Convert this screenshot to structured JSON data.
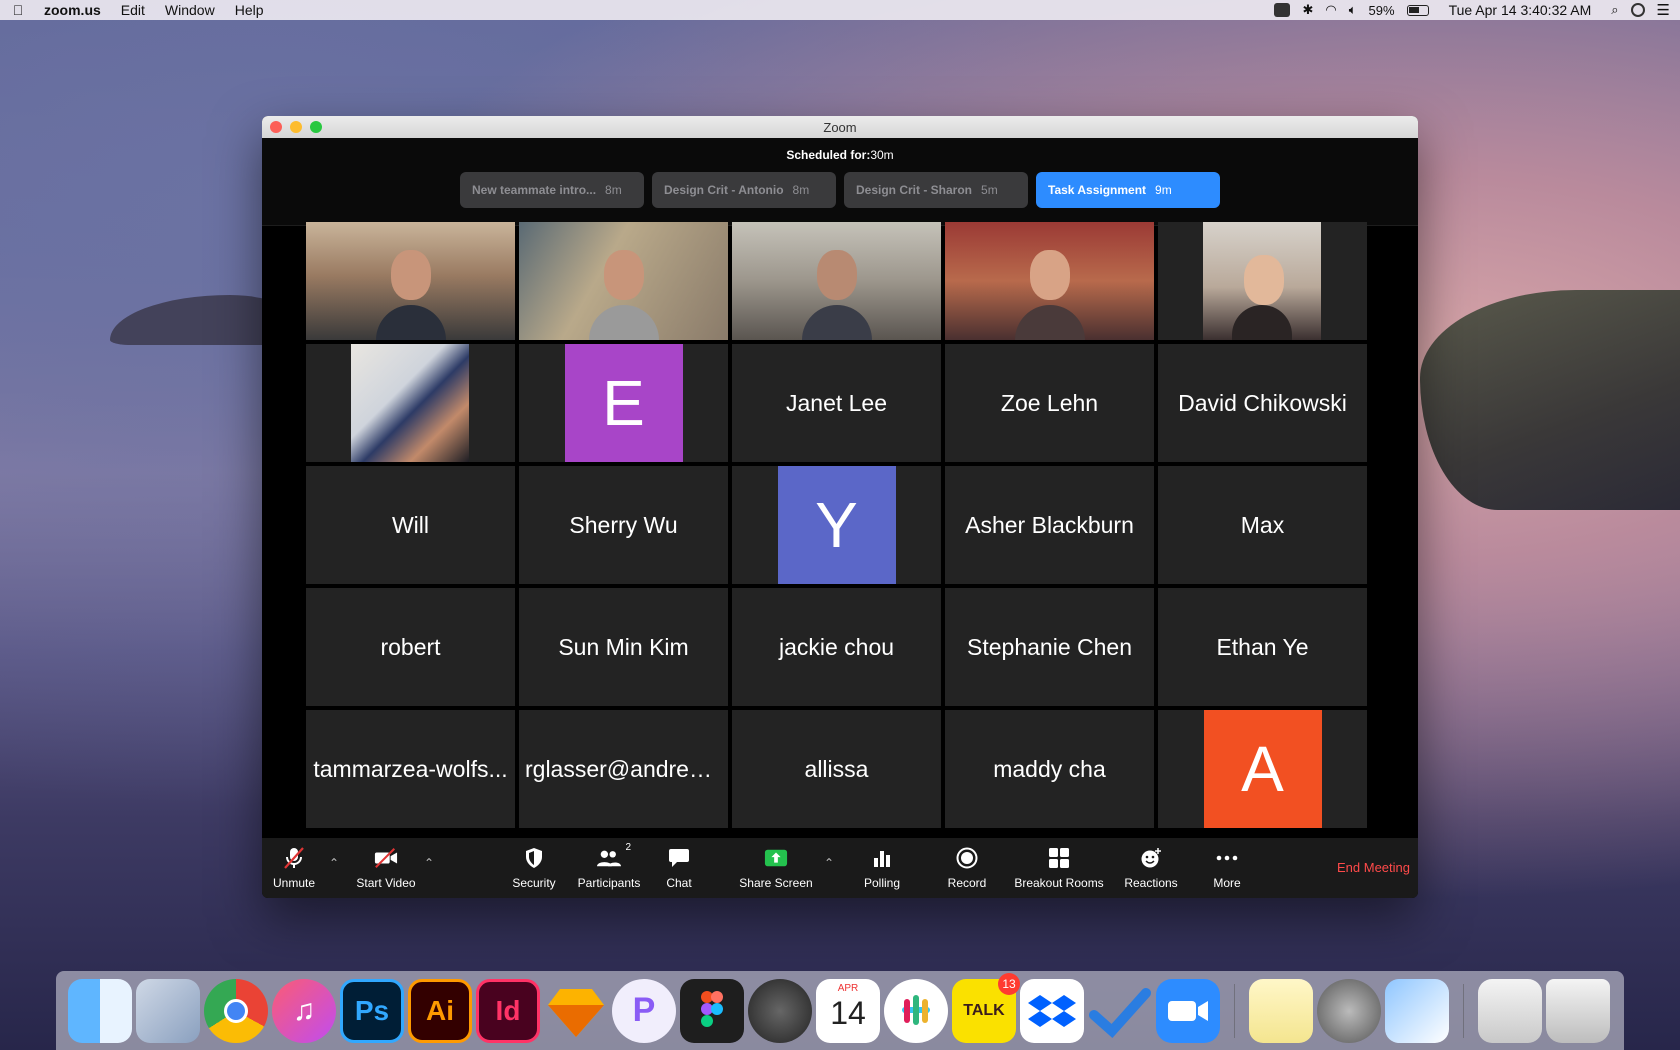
{
  "menubar": {
    "app_name": "zoom.us",
    "menus": [
      "Edit",
      "Window",
      "Help"
    ],
    "battery": "59%",
    "datetime": "Tue Apr 14  3:40:32 AM"
  },
  "window": {
    "title": "Zoom"
  },
  "agenda": {
    "scheduled_label": "Scheduled for:",
    "scheduled_value": "30m",
    "items": [
      {
        "label": "New teammate intro...",
        "duration": "8m"
      },
      {
        "label": "Design Crit - Antonio",
        "duration": "8m"
      },
      {
        "label": "Design Crit - Sharon",
        "duration": "5m"
      },
      {
        "label": "Task Assignment",
        "duration": "9m"
      }
    ]
  },
  "participants": {
    "row2": [
      "E",
      "Janet Lee",
      "Zoe Lehn",
      "David Chikowski"
    ],
    "row3": [
      "Will",
      "Sherry Wu",
      "Y",
      "Asher Blackburn",
      "Max"
    ],
    "row4": [
      "robert",
      "Sun Min Kim",
      "jackie chou",
      "Stephanie Chen",
      "Ethan Ye"
    ],
    "row5": [
      "tammarzea-wolfs...",
      "rglasser@andrew...",
      "allissa",
      "maddy cha",
      "A"
    ]
  },
  "colors": {
    "accent": "#2d8cff",
    "avatar_e": "#a845c8",
    "avatar_y": "#5b67c8",
    "avatar_a": "#f25022",
    "end": "#ff4a4a"
  },
  "toolbar": {
    "unmute": "Unmute",
    "start_video": "Start Video",
    "security": "Security",
    "participants": "Participants",
    "participants_count": "2",
    "chat": "Chat",
    "share_screen": "Share Screen",
    "polling": "Polling",
    "record": "Record",
    "breakout": "Breakout Rooms",
    "reactions": "Reactions",
    "more": "More",
    "end_meeting": "End Meeting"
  },
  "dock": {
    "photoshop": "Ps",
    "illustrator": "Ai",
    "indesign": "Id",
    "calendar_month": "APR",
    "calendar_day": "14",
    "talk_label": "TALK",
    "talk_badge": "13"
  }
}
